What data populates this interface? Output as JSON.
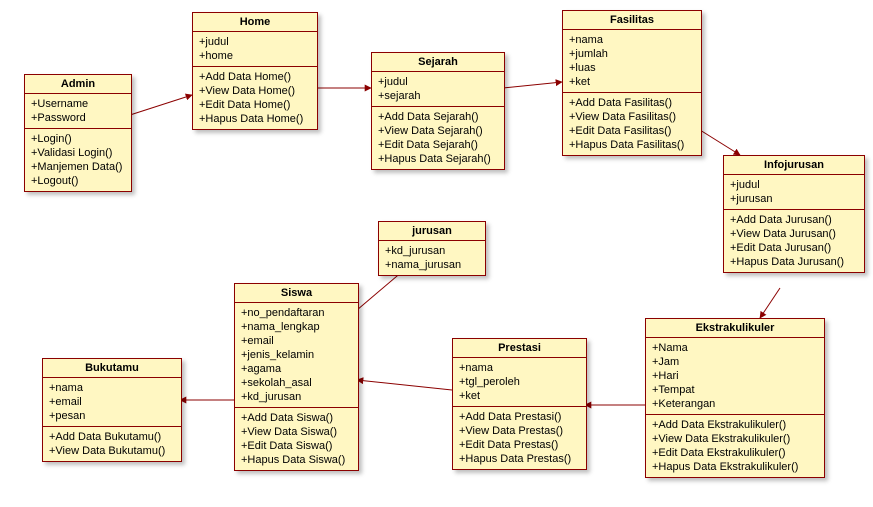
{
  "classes": {
    "admin": {
      "title": "Admin",
      "attrs": [
        "+Username",
        "+Password"
      ],
      "ops": [
        "+Login()",
        "+Validasi Login()",
        "+Manjemen Data()",
        "+Logout()"
      ]
    },
    "home": {
      "title": "Home",
      "attrs": [
        "+judul",
        "+home"
      ],
      "ops": [
        "+Add Data Home()",
        "+View Data Home()",
        "+Edit Data Home()",
        "+Hapus Data Home()"
      ]
    },
    "sejarah": {
      "title": "Sejarah",
      "attrs": [
        "+judul",
        "+sejarah"
      ],
      "ops": [
        "+Add Data Sejarah()",
        "+View Data Sejarah()",
        "+Edit Data Sejarah()",
        "+Hapus Data Sejarah()"
      ]
    },
    "fasilitas": {
      "title": "Fasilitas",
      "attrs": [
        "+nama",
        "+jumlah",
        "+luas",
        "+ket"
      ],
      "ops": [
        "+Add Data Fasilitas()",
        "+View Data Fasilitas()",
        "+Edit  Data Fasilitas()",
        "+Hapus  Data Fasilitas()"
      ]
    },
    "infojurusan": {
      "title": "Infojurusan",
      "attrs": [
        "+judul",
        "+jurusan"
      ],
      "ops": [
        "+Add Data Jurusan()",
        "+View Data Jurusan()",
        "+Edit  Data Jurusan()",
        "+Hapus  Data Jurusan()"
      ]
    },
    "jurusan": {
      "title": "jurusan",
      "attrs": [
        "+kd_jurusan",
        "+nama_jurusan"
      ],
      "ops": []
    },
    "siswa": {
      "title": "Siswa",
      "attrs": [
        "+no_pendaftaran",
        "+nama_lengkap",
        "+email",
        "+jenis_kelamin",
        "+agama",
        "+sekolah_asal",
        "+kd_jurusan"
      ],
      "ops": [
        "+Add Data Siswa()",
        "+View Data Siswa()",
        "+Edit Data Siswa()",
        "+Hapus Data Siswa()"
      ]
    },
    "prestasi": {
      "title": "Prestasi",
      "attrs": [
        "+nama",
        "+tgl_peroleh",
        "+ket"
      ],
      "ops": [
        "+Add Data Prestasi()",
        "+View Data Prestas()",
        "+Edit Data Prestas()",
        "+Hapus Data Prestas()"
      ]
    },
    "ekstra": {
      "title": "Ekstrakulikuler",
      "attrs": [
        "+Nama",
        "+Jam",
        "+Hari",
        "+Tempat",
        "+Keterangan"
      ],
      "ops": [
        "+Add Data Ekstrakulikuler()",
        "+View Data Ekstrakulikuler()",
        "+Edit Data Ekstrakulikuler()",
        "+Hapus Data Ekstrakulikuler()"
      ]
    },
    "bukutamu": {
      "title": "Bukutamu",
      "attrs": [
        "+nama",
        "+email",
        "+pesan"
      ],
      "ops": [
        "+Add Data Bukutamu()",
        "+View Data Bukutamu()"
      ]
    }
  },
  "chart_data": {
    "type": "uml-class-diagram",
    "classes": [
      {
        "name": "Admin",
        "attributes": [
          "Username",
          "Password"
        ],
        "operations": [
          "Login()",
          "Validasi Login()",
          "Manjemen Data()",
          "Logout()"
        ]
      },
      {
        "name": "Home",
        "attributes": [
          "judul",
          "home"
        ],
        "operations": [
          "Add Data Home()",
          "View Data Home()",
          "Edit Data Home()",
          "Hapus Data Home()"
        ]
      },
      {
        "name": "Sejarah",
        "attributes": [
          "judul",
          "sejarah"
        ],
        "operations": [
          "Add Data Sejarah()",
          "View Data Sejarah()",
          "Edit Data Sejarah()",
          "Hapus Data Sejarah()"
        ]
      },
      {
        "name": "Fasilitas",
        "attributes": [
          "nama",
          "jumlah",
          "luas",
          "ket"
        ],
        "operations": [
          "Add Data Fasilitas()",
          "View Data Fasilitas()",
          "Edit Data Fasilitas()",
          "Hapus Data Fasilitas()"
        ]
      },
      {
        "name": "Infojurusan",
        "attributes": [
          "judul",
          "jurusan"
        ],
        "operations": [
          "Add Data Jurusan()",
          "View Data Jurusan()",
          "Edit Data Jurusan()",
          "Hapus Data Jurusan()"
        ]
      },
      {
        "name": "jurusan",
        "attributes": [
          "kd_jurusan",
          "nama_jurusan"
        ],
        "operations": []
      },
      {
        "name": "Siswa",
        "attributes": [
          "no_pendaftaran",
          "nama_lengkap",
          "email",
          "jenis_kelamin",
          "agama",
          "sekolah_asal",
          "kd_jurusan"
        ],
        "operations": [
          "Add Data Siswa()",
          "View Data Siswa()",
          "Edit Data Siswa()",
          "Hapus Data Siswa()"
        ]
      },
      {
        "name": "Prestasi",
        "attributes": [
          "nama",
          "tgl_peroleh",
          "ket"
        ],
        "operations": [
          "Add Data Prestasi()",
          "View Data Prestas()",
          "Edit Data Prestas()",
          "Hapus Data Prestas()"
        ]
      },
      {
        "name": "Ekstrakulikuler",
        "attributes": [
          "Nama",
          "Jam",
          "Hari",
          "Tempat",
          "Keterangan"
        ],
        "operations": [
          "Add Data Ekstrakulikuler()",
          "View Data Ekstrakulikuler()",
          "Edit Data Ekstrakulikuler()",
          "Hapus Data Ekstrakulikuler()"
        ]
      },
      {
        "name": "Bukutamu",
        "attributes": [
          "nama",
          "email",
          "pesan"
        ],
        "operations": [
          "Add Data Bukutamu()",
          "View Data Bukutamu()"
        ]
      }
    ],
    "associations": [
      {
        "from": "Admin",
        "to": "Home"
      },
      {
        "from": "Home",
        "to": "Sejarah"
      },
      {
        "from": "Sejarah",
        "to": "Fasilitas"
      },
      {
        "from": "Fasilitas",
        "to": "Infojurusan"
      },
      {
        "from": "Infojurusan",
        "to": "Ekstrakulikuler"
      },
      {
        "from": "Ekstrakulikuler",
        "to": "Prestasi"
      },
      {
        "from": "Prestasi",
        "to": "Siswa"
      },
      {
        "from": "Siswa",
        "to": "jurusan"
      },
      {
        "from": "Siswa",
        "to": "Bukutamu"
      }
    ]
  }
}
